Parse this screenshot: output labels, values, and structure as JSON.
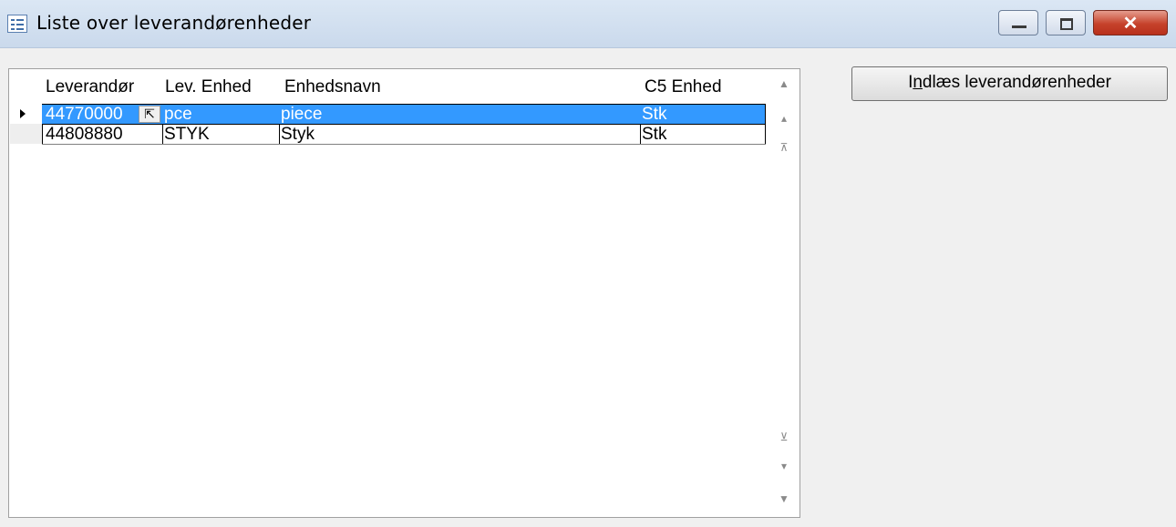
{
  "window": {
    "title": "Liste over leverandørenheder",
    "close_glyph": "✕",
    "icons": [
      "list-icon",
      "minimize-icon",
      "maximize-icon",
      "close-icon"
    ]
  },
  "grid": {
    "columns": [
      "Leverandør",
      "Lev. Enhed",
      "Enhedsnavn",
      "C5 Enhed"
    ],
    "rows": [
      {
        "leverandor": "44770000",
        "lev_enhed": "pce",
        "enhedsnavn": "piece",
        "c5_enhed": "Stk",
        "selected": true
      },
      {
        "leverandor": "44808880",
        "lev_enhed": "STYK",
        "enhedsnavn": "Styk",
        "c5_enhed": "Stk",
        "selected": false
      }
    ],
    "lookup_glyph": "⇱",
    "nav": {
      "first": "▲",
      "prev_page": "▴",
      "top": "⊼",
      "bottom": "⊻",
      "next_page": "▾",
      "last": "▼"
    }
  },
  "actions": {
    "load_button": "Indlæs leverandørenheder",
    "load_button_access_key": "n"
  },
  "colors": {
    "selection": "#3399ff",
    "title_bar": "#d3e1f2",
    "close_button": "#c6422b"
  }
}
